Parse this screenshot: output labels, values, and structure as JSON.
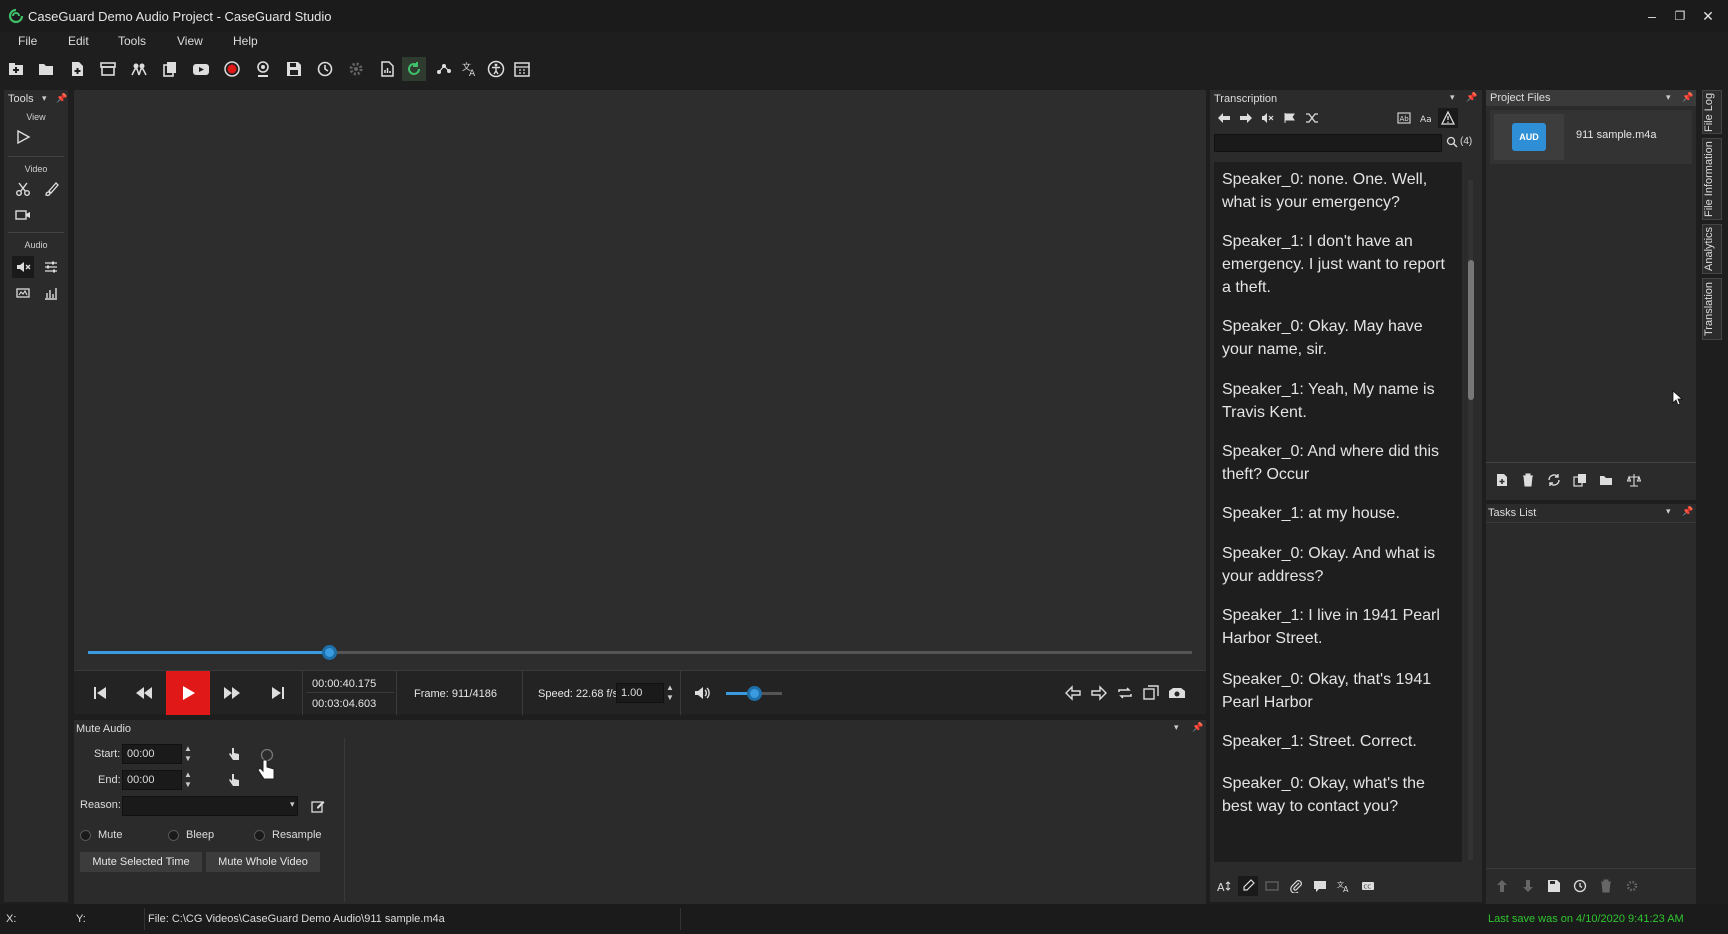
{
  "window": {
    "title": "CaseGuard Demo Audio Project - CaseGuard Studio",
    "minimize": "–",
    "restore": "❐",
    "close": "✕"
  },
  "menu": [
    "File",
    "Edit",
    "Tools",
    "View",
    "Help"
  ],
  "toolbar": {
    "icons": [
      "new-project-icon",
      "open-folder-icon",
      "add-file-icon",
      "archive-icon",
      "detect-people-icon",
      "copy-icon",
      "youtube-icon",
      "record-icon",
      "webcam-icon",
      "save-icon",
      "history-icon",
      "settings-gear-icon",
      "report-icon",
      "refresh-green-icon",
      "network-icon",
      "translate-icon",
      "accessibility-icon",
      "calendar-icon"
    ]
  },
  "tools_panel": {
    "title": "Tools",
    "sections": {
      "view": "View",
      "video": "Video",
      "audio": "Audio"
    }
  },
  "player": {
    "current_time": "00:00:40.175",
    "total_time": "00:03:04.603",
    "frame": "Frame: 911/4186",
    "speed_label": "Speed: 22.68 f/s",
    "speed_value": "1.00",
    "progress": 0.218,
    "volume": 0.5
  },
  "mute_audio": {
    "title": "Mute Audio",
    "start_label": "Start:",
    "start_value": "00:00",
    "end_label": "End:",
    "end_value": "00:00",
    "reason_label": "Reason:",
    "options": [
      "Mute",
      "Bleep",
      "Resample"
    ],
    "mute_selected_btn": "Mute Selected Time",
    "mute_whole_btn": "Mute Whole Video"
  },
  "transcription": {
    "title": "Transcription",
    "match_count": "(4)",
    "utterances": [
      "Speaker_0: none. One. Well, what is your emergency?",
      "Speaker_1: I don't have an emergency. I just want to report a theft.",
      "Speaker_0: Okay. May have your name, sir.",
      "Speaker_1: Yeah, My name is Travis Kent.",
      "Speaker_0: And where did this theft? Occur",
      "Speaker_1: at my house.",
      "Speaker_0: Okay. And what is your address?",
      "Speaker_1: I live in 1941 Pearl Harbor Street.",
      "Speaker_0: Okay, that's 1941 Pearl Harbor",
      "Speaker_1: Street. Correct.",
      "Speaker_0: Okay, what's the best way to contact you?"
    ]
  },
  "project_files": {
    "title": "Project Files",
    "file_name": "911 sample.m4a",
    "thumb_label": "AUD"
  },
  "tasks": {
    "title": "Tasks List"
  },
  "side_tabs": [
    "File Log",
    "File Information",
    "Analytics",
    "Translation"
  ],
  "status": {
    "x_label": "X:",
    "y_label": "Y:",
    "file_path": "File: C:\\CG Videos\\CaseGuard Demo Audio\\911 sample.m4a",
    "last_save": "Last save was on 4/10/2020 9:41:23 AM"
  },
  "colors": {
    "accent": "#3a9be0",
    "play": "#e01818",
    "save_text": "#2fc52f"
  }
}
